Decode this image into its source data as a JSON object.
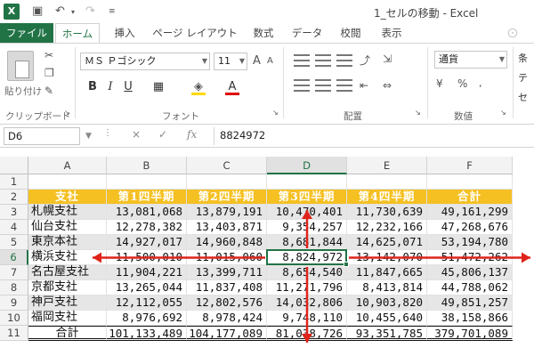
{
  "titlebar": {
    "app_badge": "X",
    "title": "1_セルの移動 - Excel"
  },
  "tabs": [
    "ファイル",
    "ホーム",
    "挿入",
    "ページ レイアウト",
    "数式",
    "データ",
    "校閲",
    "表示"
  ],
  "ribbon": {
    "paste_label": "貼り付け",
    "clipboard_label": "クリップボード",
    "font_name": "ＭＳ Ｐゴシック",
    "font_size": "11",
    "font_label": "フォント",
    "bold": "B",
    "italic": "I",
    "underline": "U",
    "align_label": "配置",
    "number_format": "通貨",
    "number_label": "数値",
    "right_partial": [
      "条",
      "テ",
      "セ"
    ]
  },
  "formula_bar": {
    "cell_ref": "D6",
    "cancel": "×",
    "enter": "✓",
    "fx": "fx",
    "content": "8824972"
  },
  "sheet": {
    "columns": [
      "A",
      "B",
      "C",
      "D",
      "E",
      "F"
    ],
    "selected_column": "D",
    "selected_row": "6",
    "rows": [
      {
        "n": "1",
        "cells": [
          "",
          "",
          "",
          "",
          "",
          ""
        ]
      },
      {
        "n": "2",
        "cells": [
          "支社",
          "第1四半期",
          "第2四半期",
          "第3四半期",
          "第4四半期",
          "合計"
        ]
      },
      {
        "n": "3",
        "cells": [
          "札幌支社",
          "13,081,068",
          "13,879,191",
          "10,470,401",
          "11,730,639",
          "49,161,299"
        ]
      },
      {
        "n": "4",
        "cells": [
          "仙台支社",
          "12,278,382",
          "13,403,871",
          "9,354,257",
          "12,232,166",
          "47,268,676"
        ]
      },
      {
        "n": "5",
        "cells": [
          "東京本社",
          "14,927,017",
          "14,960,848",
          "8,681,844",
          "14,625,071",
          "53,194,780"
        ]
      },
      {
        "n": "6",
        "cells": [
          "横浜支社",
          "11,500,010",
          "11,015,060",
          "8,824,972",
          "13,142,070",
          "51,472,262"
        ]
      },
      {
        "n": "7",
        "cells": [
          "名古屋支社",
          "11,904,221",
          "13,399,711",
          "8,654,540",
          "11,847,665",
          "45,806,137"
        ]
      },
      {
        "n": "8",
        "cells": [
          "京都支社",
          "13,265,044",
          "11,837,408",
          "11,271,796",
          "8,413,814",
          "44,788,062"
        ]
      },
      {
        "n": "9",
        "cells": [
          "神戸支社",
          "12,112,055",
          "12,802,576",
          "14,032,806",
          "10,903,820",
          "49,851,257"
        ]
      },
      {
        "n": "10",
        "cells": [
          "福岡支社",
          "8,976,692",
          "8,978,424",
          "9,748,110",
          "10,455,640",
          "38,158,866"
        ]
      },
      {
        "n": "11",
        "cells": [
          "合計",
          "101,133,489",
          "104,177,089",
          "81,038,726",
          "93,351,785",
          "379,701,089"
        ]
      }
    ]
  },
  "colors": {
    "brand": "#217346",
    "header_fill": "#f5c022",
    "arrow": "#e0241b",
    "band": "#e6e6e6"
  }
}
